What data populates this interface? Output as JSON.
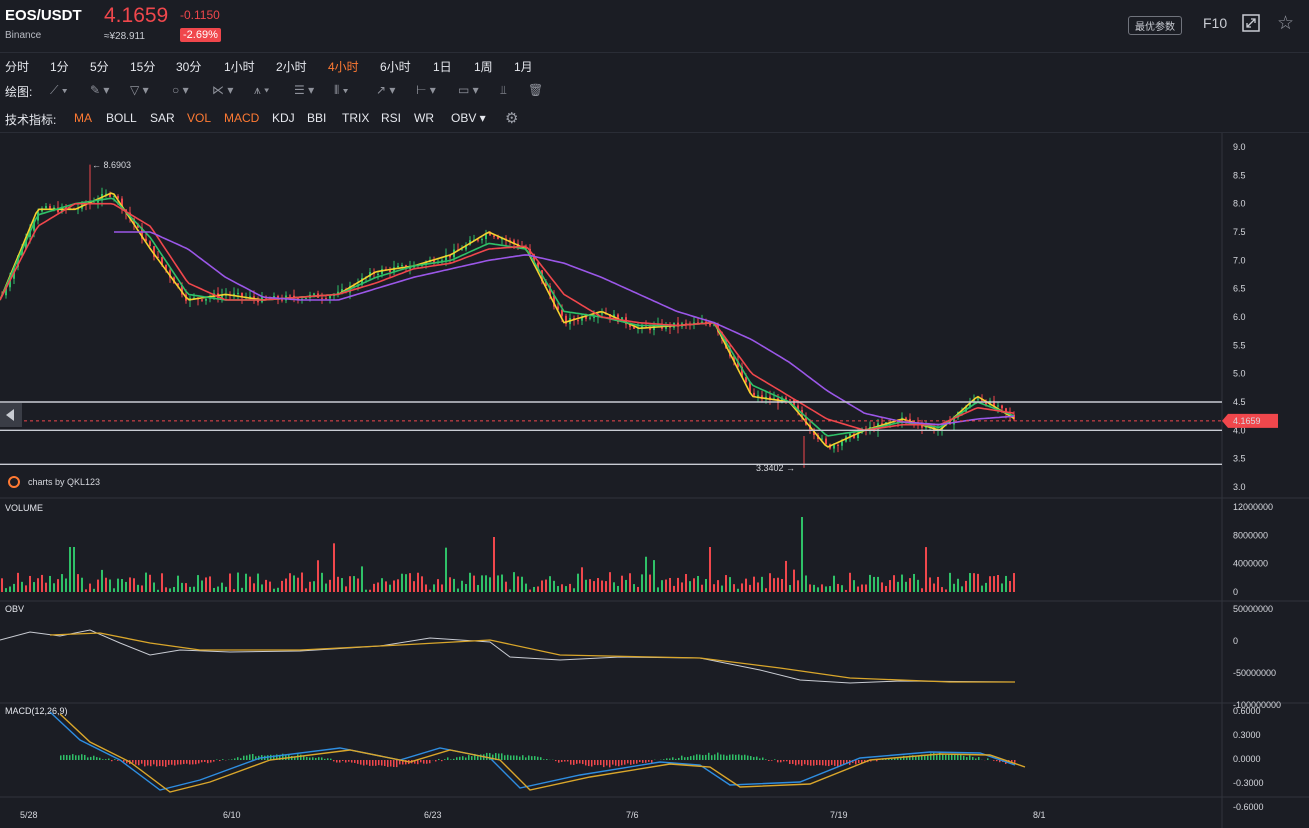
{
  "header": {
    "pair": "EOS/USDT",
    "exchange": "Binance",
    "price": "4.1659",
    "price_cny": "≈¥28.911",
    "change": "-0.1150",
    "change_pct": "-2.69%",
    "param_button": "最优参数",
    "f10": "F10",
    "fullscreen_icon": "fullscreen-icon",
    "favorite_icon": "star-icon"
  },
  "intervals": [
    "分时",
    "1分",
    "5分",
    "15分",
    "30分",
    "1小时",
    "2小时",
    "4小时",
    "6小时",
    "1日",
    "1周",
    "1月"
  ],
  "active_interval": "4小时",
  "drawing": {
    "label": "绘图:",
    "tools": [
      "line-tool-icon",
      "pen-tool-icon",
      "channel-tool-icon",
      "circle-tool-icon",
      "zigzag-tool-icon",
      "pattern-tool-icon",
      "fib-tool-icon",
      "gann-tool-icon",
      "arrow-tool-icon",
      "range-tool-icon",
      "note-tool-icon",
      "measure-tool-icon",
      "trash-icon"
    ]
  },
  "indicators": {
    "label": "技术指标:",
    "items": [
      "MA",
      "BOLL",
      "SAR",
      "VOL",
      "MACD",
      "KDJ",
      "BBI",
      "TRIX",
      "RSI",
      "WR",
      "OBV"
    ],
    "active": [
      "MA",
      "VOL",
      "MACD"
    ],
    "settings_icon": "gear-icon"
  },
  "chart_data": {
    "type": "candlestick",
    "x_ticks": [
      "5/28",
      "6/10",
      "6/23",
      "7/6",
      "7/19",
      "8/1"
    ],
    "price_axis": [
      "9.0",
      "8.5",
      "8.0",
      "7.5",
      "7.0",
      "6.5",
      "6.0",
      "5.5",
      "5.0",
      "4.5",
      "4.0",
      "3.5",
      "3.0"
    ],
    "ylim": [
      3.0,
      9.0
    ],
    "high_marker": "8.6903",
    "low_marker": "3.3402",
    "current_price_tag": "4.1659",
    "horizontal_levels": [
      4.5,
      4.0,
      3.4
    ],
    "watermark": "charts by QKL123",
    "ma_series": [
      {
        "color": "#f5d02e",
        "values": [
          6.3,
          7.9,
          7.9,
          8.2,
          7.2,
          6.3,
          6.4,
          6.3,
          6.35,
          6.4,
          6.8,
          6.9,
          7.1,
          7.5,
          7.2,
          5.9,
          6.1,
          5.8,
          5.85,
          5.9,
          4.6,
          4.5,
          3.7,
          4.0,
          4.2,
          4.0,
          4.6,
          4.2
        ]
      },
      {
        "color": "#2fc168",
        "values": [
          6.3,
          7.8,
          8.0,
          8.1,
          7.4,
          6.4,
          6.3,
          6.3,
          6.35,
          6.4,
          6.7,
          6.9,
          7.0,
          7.3,
          7.2,
          6.1,
          6.0,
          5.85,
          5.85,
          5.9,
          4.8,
          4.5,
          3.9,
          4.0,
          4.15,
          4.05,
          4.5,
          4.25
        ]
      },
      {
        "color": "#f0474c",
        "values": [
          6.3,
          7.6,
          8.0,
          8.0,
          7.6,
          6.6,
          6.3,
          6.3,
          6.35,
          6.4,
          6.6,
          6.85,
          6.95,
          7.2,
          7.25,
          6.4,
          6.0,
          5.9,
          5.85,
          5.9,
          5.0,
          4.6,
          4.2,
          4.0,
          4.1,
          4.1,
          4.4,
          4.3
        ]
      },
      {
        "color": "#9b57e8",
        "values": [
          null,
          null,
          null,
          7.5,
          7.5,
          7.2,
          6.7,
          6.35,
          6.3,
          6.3,
          6.5,
          6.7,
          6.85,
          7.0,
          7.1,
          6.95,
          6.7,
          6.4,
          6.1,
          5.9,
          5.6,
          5.2,
          4.7,
          4.3,
          4.15,
          4.1,
          4.2,
          4.25
        ]
      }
    ],
    "volume_axis": [
      "12000000",
      "8000000",
      "4000000",
      "0"
    ],
    "obv_axis": [
      "50000000",
      "0",
      "-50000000",
      "-100000000"
    ],
    "macd_axis": [
      "0.6000",
      "0.3000",
      "0.0000",
      "-0.3000",
      "-0.6000"
    ]
  },
  "panels": {
    "volume": "VOLUME",
    "obv": "OBV",
    "macd": "MACD(12,26,9)"
  },
  "colors": {
    "up": "#2fc168",
    "down": "#f0474c",
    "accent": "#ff7a33",
    "background": "#1b1d24"
  }
}
